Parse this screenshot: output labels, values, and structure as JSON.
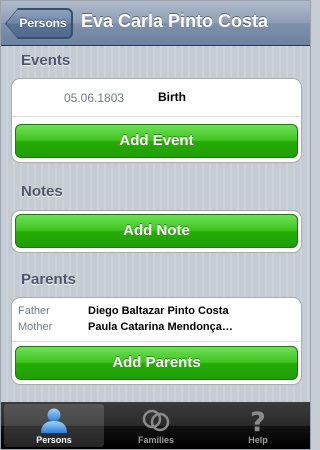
{
  "nav": {
    "back_label": "Persons",
    "title": "Eva Carla Pinto Costa"
  },
  "sections": {
    "events": {
      "header": "Events",
      "items": [
        {
          "date": "05.06.1803",
          "type": "Birth"
        }
      ],
      "add_label": "Add Event"
    },
    "notes": {
      "header": "Notes",
      "add_label": "Add Note"
    },
    "parents": {
      "header": "Parents",
      "father_label": "Father",
      "father_name": "Diego Baltazar Pinto Costa",
      "mother_label": "Mother",
      "mother_name": "Paula Catarina Mendonça…",
      "add_label": "Add Parents"
    }
  },
  "tabbar": {
    "tabs": [
      {
        "label": "Persons",
        "icon": "person-icon",
        "active": true
      },
      {
        "label": "Families",
        "icon": "rings-icon",
        "active": false
      },
      {
        "label": "Help",
        "icon": "question-icon",
        "active": false
      }
    ]
  },
  "colors": {
    "nav_bar": "#7f91ab",
    "button_green": "#26ad07",
    "section_header": "#4c566c",
    "tab_active_icon": "#4aa3f0"
  }
}
